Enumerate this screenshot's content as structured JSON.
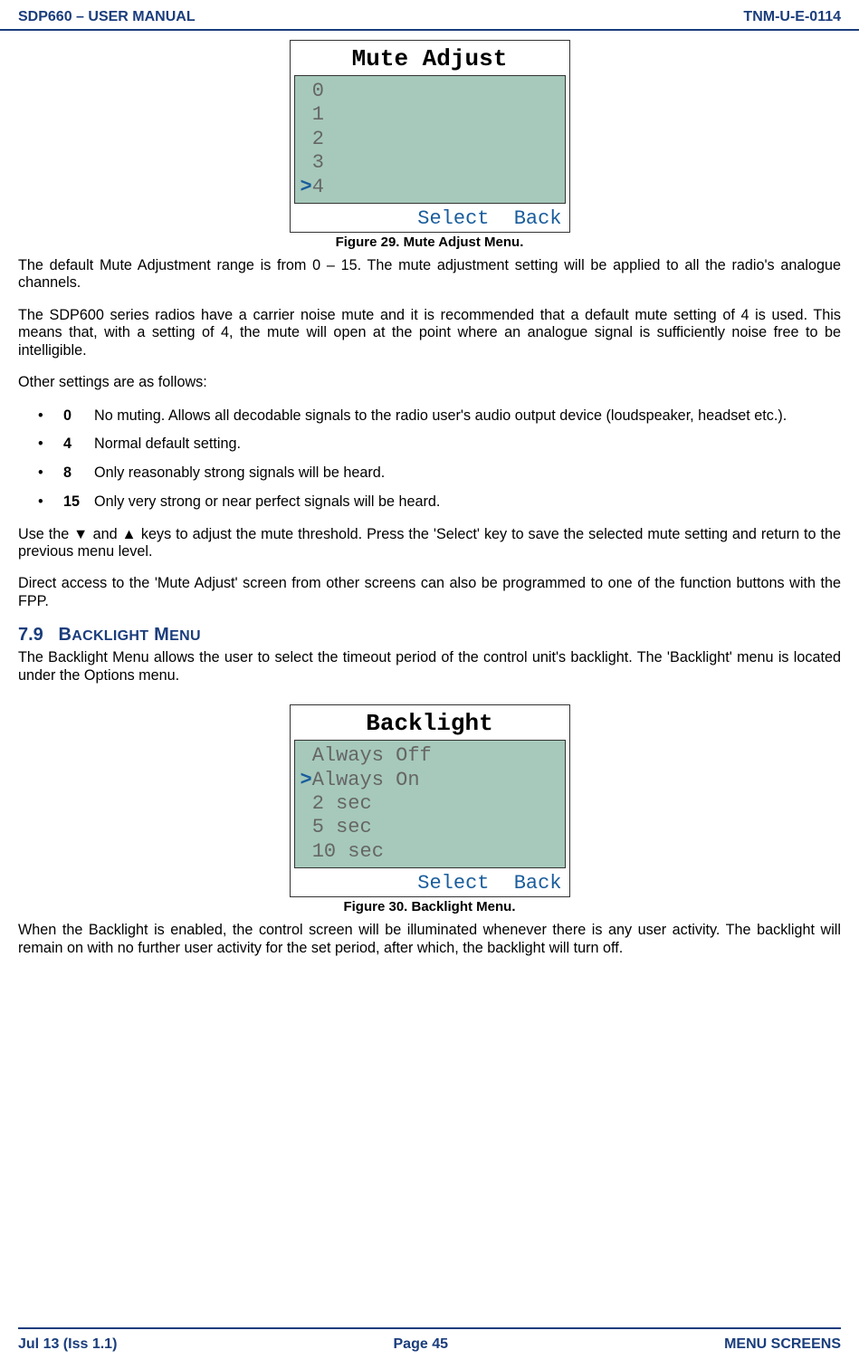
{
  "header": {
    "left": "SDP660 – USER MANUAL",
    "right": "TNM-U-E-0114"
  },
  "figure29": {
    "title": "Mute Adjust",
    "items": [
      "0",
      "1",
      "2",
      "3",
      "4"
    ],
    "cursor_index": 4,
    "footer_select": "Select",
    "footer_back": "Back",
    "caption": "Figure 29.  Mute Adjust Menu."
  },
  "para1": "The default Mute Adjustment range is from 0 – 15.  The mute adjustment setting will be applied to all the radio's analogue channels.",
  "para2": "The SDP600 series radios have a carrier noise mute and it is recommended that a default mute setting of 4 is used.  This means that, with a setting of 4, the mute will open at the point where an analogue signal is sufficiently noise free to be intelligible.",
  "para3": "Other settings are as follows:",
  "bullets": [
    {
      "num": "0",
      "text": "No muting.  Allows all decodable signals to the radio user's audio output device (loudspeaker, headset etc.)."
    },
    {
      "num": "4",
      "text": "Normal default setting."
    },
    {
      "num": "8",
      "text": "Only reasonably strong signals will be heard."
    },
    {
      "num": "15",
      "text": "Only very strong or near perfect signals will be heard."
    }
  ],
  "para4": "Use the ▼ and ▲ keys to adjust the mute threshold.  Press the 'Select' key to save the selected mute setting and return to the previous menu level.",
  "para5": "Direct access to the 'Mute Adjust' screen from other screens can also be programmed to one of the function buttons with the FPP.",
  "section79": {
    "num": "7.9",
    "title": "BACKLIGHT MENU"
  },
  "para6": "The Backlight Menu allows the user to select the timeout period of the control unit's backlight.  The 'Backlight' menu is located under the Options menu.",
  "figure30": {
    "title": "Backlight",
    "items": [
      "Always Off",
      "Always On",
      "2 sec",
      "5 sec",
      "10 sec"
    ],
    "cursor_index": 1,
    "footer_select": "Select",
    "footer_back": "Back",
    "caption": "Figure 30.  Backlight Menu."
  },
  "para7": "When the Backlight is enabled, the control screen will be illuminated whenever there is any user activity.  The backlight will remain on with no further user activity for the set period, after which, the backlight will turn off.",
  "footer": {
    "left": "Jul 13 (Iss 1.1)",
    "center": "Page 45",
    "right": "MENU SCREENS"
  }
}
